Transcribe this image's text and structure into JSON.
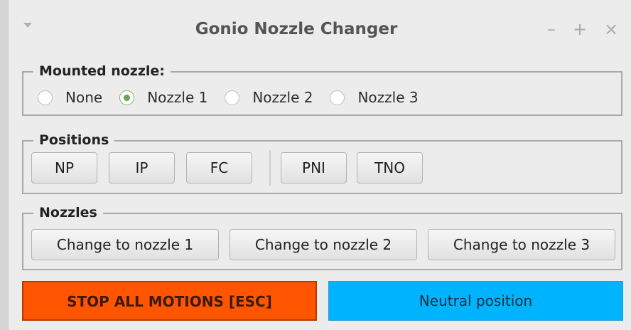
{
  "window": {
    "title": "Gonio Nozzle Changer",
    "controls": {
      "minimize": "–",
      "maximize": "+",
      "close": "×"
    }
  },
  "mounted_nozzle": {
    "label": "Mounted nozzle:",
    "options": [
      "None",
      "Nozzle 1",
      "Nozzle 2",
      "Nozzle 3"
    ],
    "selected": "Nozzle 1"
  },
  "positions": {
    "label": "Positions",
    "buttons": [
      "NP",
      "IP",
      "FC",
      "PNI",
      "TNO"
    ]
  },
  "nozzles": {
    "label": "Nozzles",
    "buttons": [
      "Change to nozzle 1",
      "Change to nozzle 2",
      "Change to nozzle 3"
    ]
  },
  "actions": {
    "stop": "STOP ALL MOTIONS [ESC]",
    "neutral": "Neutral position"
  },
  "colors": {
    "stop_bg": "#ff5500",
    "neutral_bg": "#00b3ff",
    "radio_checked": "#6aa35a"
  }
}
